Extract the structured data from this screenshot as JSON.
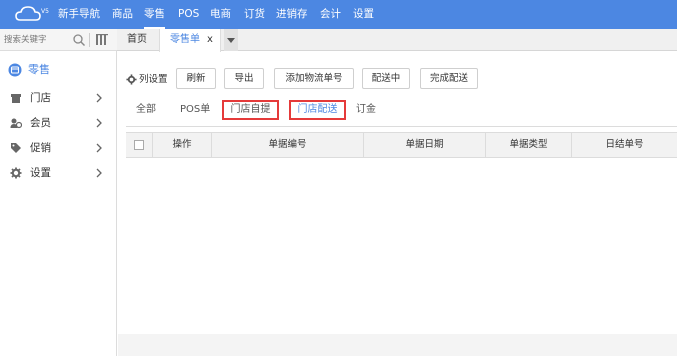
{
  "brand": {
    "logo": "cloud-logo-icon",
    "version_mark": "V5"
  },
  "nav": {
    "items": [
      {
        "label": "新手导航"
      },
      {
        "label": "商品"
      },
      {
        "label": "零售"
      },
      {
        "label": "POS"
      },
      {
        "label": "电商"
      },
      {
        "label": "订货"
      },
      {
        "label": "进销存"
      },
      {
        "label": "会计"
      },
      {
        "label": "设置"
      }
    ],
    "active": "零售"
  },
  "sidebar": {
    "search_placeholder": "搜索关键字",
    "module_title": "零售",
    "items": [
      {
        "label": "门店",
        "icon": "store-icon"
      },
      {
        "label": "会员",
        "icon": "member-icon"
      },
      {
        "label": "促销",
        "icon": "tag-icon"
      },
      {
        "label": "设置",
        "icon": "gear-icon"
      }
    ]
  },
  "tabs": {
    "home": "首页",
    "active": "零售单",
    "close": "x"
  },
  "toolbar": {
    "column_settings": "列设置",
    "buttons": [
      "刷新",
      "导出",
      "添加物流单号",
      "配送中",
      "完成配送"
    ]
  },
  "subtabs": [
    "全部",
    "POS单",
    "门店自提",
    "门店配送",
    "订金"
  ],
  "active_subtab": "门店配送",
  "table": {
    "headers": [
      "操作",
      "单据编号",
      "单据日期",
      "单据类型",
      "日结单号"
    ]
  },
  "colors": {
    "brand": "#4c87e2",
    "highlight_box": "#e53a3a"
  }
}
